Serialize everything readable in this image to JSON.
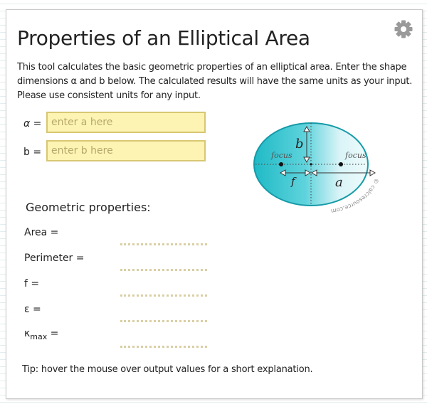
{
  "title": "Properties of an Elliptical Area",
  "description": "This tool calculates the basic geometric properties of an elliptical area. Enter the shape dimensions α and b below. The calculated results will have the same units as your input. Please use consistent units for any input.",
  "settings_icon": "gear-icon",
  "inputs": {
    "a": {
      "symbol": "α",
      "eq": " =",
      "placeholder": "enter a here",
      "value": ""
    },
    "b": {
      "symbol": "b",
      "eq": " =",
      "placeholder": "enter b here",
      "value": ""
    }
  },
  "diagram": {
    "focus_left": "focus",
    "focus_right": "focus",
    "label_b": "b",
    "label_f": "f",
    "label_a": "a",
    "watermark": "© calcresource.com"
  },
  "section_heading": "Geometric properties:",
  "outputs": [
    {
      "label": "Area =",
      "value": ""
    },
    {
      "label": "Perimeter =",
      "value": ""
    },
    {
      "label": "f =",
      "value": ""
    },
    {
      "label": "ε =",
      "value": ""
    },
    {
      "label": "κ",
      "sub": "max",
      "tail": " =",
      "value": ""
    }
  ],
  "tip": "Tip: hover the mouse over output values for a short explanation.",
  "colors": {
    "input_bg": "#fdf3b3",
    "input_border": "#d8c773",
    "ellipse_fill": "#21bdc9",
    "ellipse_stroke": "#159aa8",
    "gear": "#9a9a9a"
  }
}
